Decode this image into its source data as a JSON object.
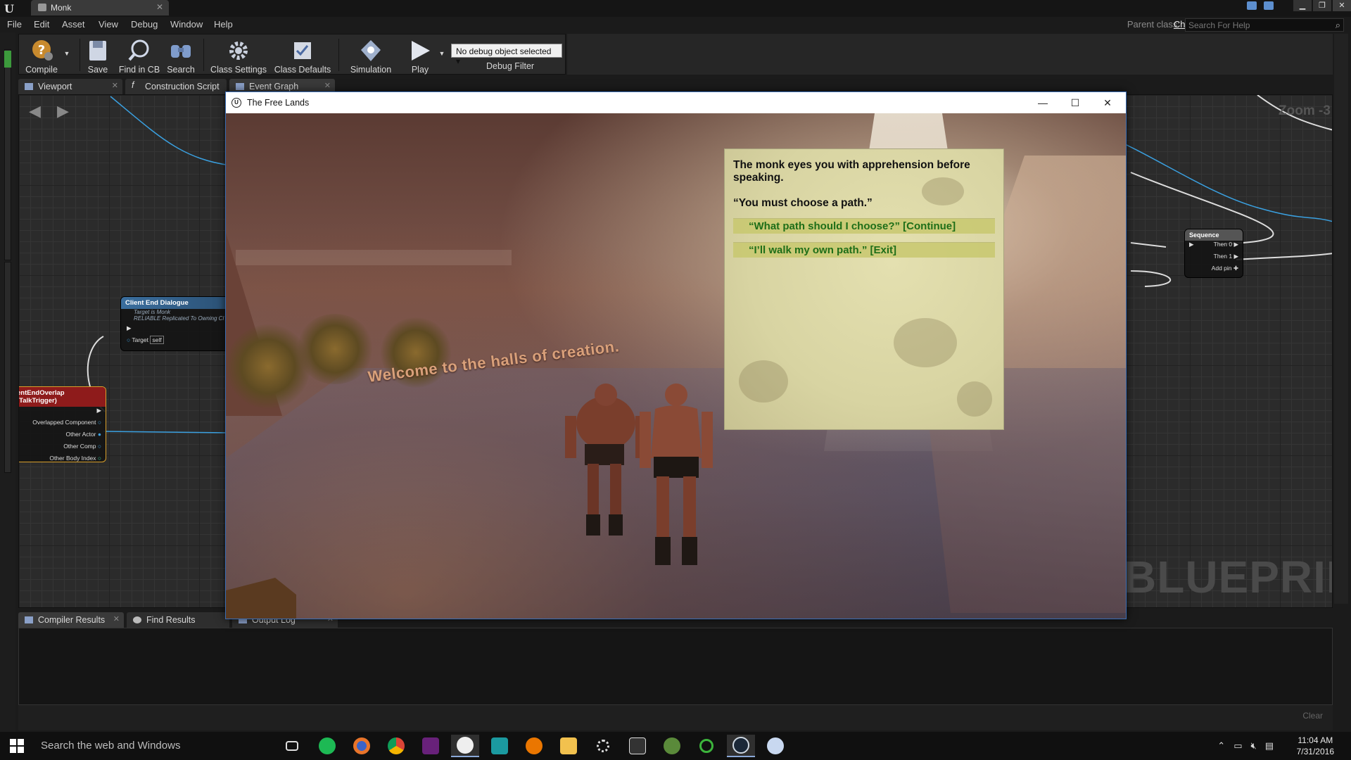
{
  "editor": {
    "doc_tab": "Monk",
    "menu": [
      "File",
      "Edit",
      "Asset",
      "View",
      "Debug",
      "Window",
      "Help"
    ],
    "parent_class_label": "Parent class:",
    "parent_class_value": "Character",
    "help_search_placeholder": "Search For Help",
    "toolbar": {
      "compile": "Compile",
      "save": "Save",
      "find_in_cb": "Find in CB",
      "search": "Search",
      "class_settings": "Class Settings",
      "class_defaults": "Class Defaults",
      "simulation": "Simulation",
      "play": "Play",
      "debug_object": "No debug object selected",
      "debug_filter": "Debug Filter"
    },
    "panel_tabs": [
      "Viewport",
      "Construction Script",
      "Event Graph"
    ],
    "graph": {
      "zoom": "Zoom -3",
      "watermark": "BLUEPRINT",
      "nodes": {
        "client_end_dialogue": {
          "title": "Client End Dialogue",
          "sub1": "Target is Monk",
          "sub2": "RELIABLE Replicated To Owning Cl",
          "target_label": "Target",
          "target_value": "self"
        },
        "end_overlap": {
          "title": "entEndOverlap (TalkTrigger)",
          "pins": [
            "Overlapped Component",
            "Other Actor",
            "Other Comp",
            "Other Body Index"
          ]
        },
        "sequence": {
          "title": "Sequence",
          "pins": [
            "Then 0",
            "Then 1"
          ],
          "add_pin": "Add pin"
        }
      }
    },
    "bottom_tabs": [
      "Compiler Results",
      "Find Results",
      "Output Log"
    ],
    "clear": "Clear"
  },
  "game": {
    "window_title": "The Free Lands",
    "sign_text": "Welcome to the halls of creation.",
    "dialogue": {
      "narration": "The monk eyes you with apprehension before speaking.",
      "quote": "“You must choose a path.”",
      "choices": [
        "“What path should I choose?” [Continue]",
        "“I’ll walk my own path.” [Exit]"
      ]
    }
  },
  "taskbar": {
    "search_placeholder": "Search the web and Windows",
    "apps": [
      "task-view",
      "spotify",
      "firefox",
      "chrome",
      "visual-studio",
      "unreal-engine",
      "3ds-max",
      "blender",
      "file-explorer",
      "settings",
      "epic-games",
      "tree-app",
      "xbox",
      "steam",
      "paint-app"
    ],
    "time": "11:04 AM",
    "date": "7/31/2016"
  },
  "colors": {
    "accent": "#3a6db5",
    "dialog_choice": "#1e6e18",
    "graph_bg": "#2b2b2b"
  }
}
